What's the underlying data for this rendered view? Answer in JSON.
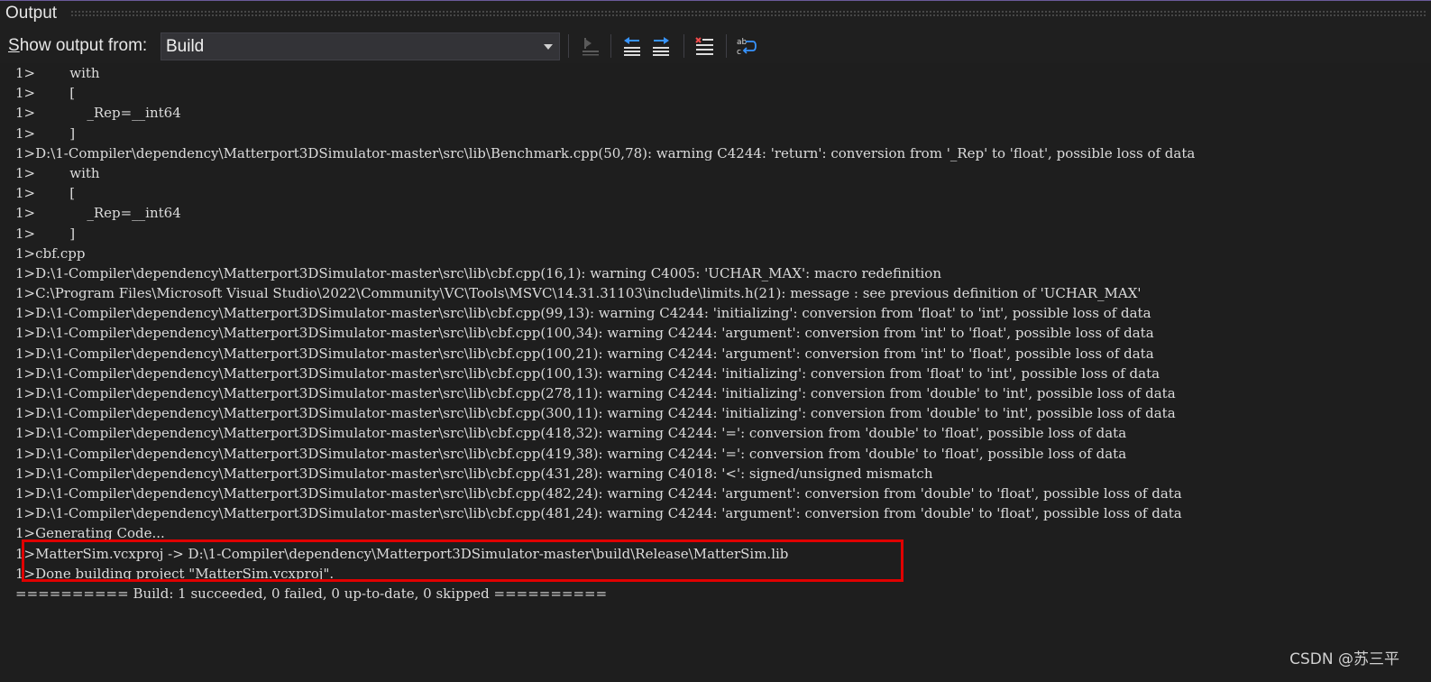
{
  "window": {
    "title": "Output"
  },
  "toolbar": {
    "show_output_label_underlined": "S",
    "show_output_label_rest": "how output from:",
    "source_value": "Build",
    "buttons": [
      {
        "name": "find-message-in-code-icon"
      },
      {
        "name": "go-to-previous-message-icon"
      },
      {
        "name": "go-to-next-message-icon"
      },
      {
        "name": "clear-all-icon"
      },
      {
        "name": "toggle-word-wrap-icon"
      }
    ]
  },
  "output": {
    "lines": [
      "1>        with",
      "1>        [",
      "1>            _Rep=__int64",
      "1>        ]",
      "1>D:\\1-Compiler\\dependency\\Matterport3DSimulator-master\\src\\lib\\Benchmark.cpp(50,78): warning C4244: 'return': conversion from '_Rep' to 'float', possible loss of data",
      "1>        with",
      "1>        [",
      "1>            _Rep=__int64",
      "1>        ]",
      "1>cbf.cpp",
      "1>D:\\1-Compiler\\dependency\\Matterport3DSimulator-master\\src\\lib\\cbf.cpp(16,1): warning C4005: 'UCHAR_MAX': macro redefinition",
      "1>C:\\Program Files\\Microsoft Visual Studio\\2022\\Community\\VC\\Tools\\MSVC\\14.31.31103\\include\\limits.h(21): message : see previous definition of 'UCHAR_MAX'",
      "1>D:\\1-Compiler\\dependency\\Matterport3DSimulator-master\\src\\lib\\cbf.cpp(99,13): warning C4244: 'initializing': conversion from 'float' to 'int', possible loss of data",
      "1>D:\\1-Compiler\\dependency\\Matterport3DSimulator-master\\src\\lib\\cbf.cpp(100,34): warning C4244: 'argument': conversion from 'int' to 'float', possible loss of data",
      "1>D:\\1-Compiler\\dependency\\Matterport3DSimulator-master\\src\\lib\\cbf.cpp(100,21): warning C4244: 'argument': conversion from 'int' to 'float', possible loss of data",
      "1>D:\\1-Compiler\\dependency\\Matterport3DSimulator-master\\src\\lib\\cbf.cpp(100,13): warning C4244: 'initializing': conversion from 'float' to 'int', possible loss of data",
      "1>D:\\1-Compiler\\dependency\\Matterport3DSimulator-master\\src\\lib\\cbf.cpp(278,11): warning C4244: 'initializing': conversion from 'double' to 'int', possible loss of data",
      "1>D:\\1-Compiler\\dependency\\Matterport3DSimulator-master\\src\\lib\\cbf.cpp(300,11): warning C4244: 'initializing': conversion from 'double' to 'int', possible loss of data",
      "1>D:\\1-Compiler\\dependency\\Matterport3DSimulator-master\\src\\lib\\cbf.cpp(418,32): warning C4244: '=': conversion from 'double' to 'float', possible loss of data",
      "1>D:\\1-Compiler\\dependency\\Matterport3DSimulator-master\\src\\lib\\cbf.cpp(419,38): warning C4244: '=': conversion from 'double' to 'float', possible loss of data",
      "1>D:\\1-Compiler\\dependency\\Matterport3DSimulator-master\\src\\lib\\cbf.cpp(431,28): warning C4018: '<': signed/unsigned mismatch",
      "1>D:\\1-Compiler\\dependency\\Matterport3DSimulator-master\\src\\lib\\cbf.cpp(482,24): warning C4244: 'argument': conversion from 'double' to 'float', possible loss of data",
      "1>D:\\1-Compiler\\dependency\\Matterport3DSimulator-master\\src\\lib\\cbf.cpp(481,24): warning C4244: 'argument': conversion from 'double' to 'float', possible loss of data",
      "1>Generating Code...",
      "1>MatterSim.vcxproj -> D:\\1-Compiler\\dependency\\Matterport3DSimulator-master\\build\\Release\\MatterSim.lib",
      "1>Done building project \"MatterSim.vcxproj\".",
      "========== Build: 1 succeeded, 0 failed, 0 up-to-date, 0 skipped =========="
    ]
  },
  "watermark": {
    "text": "CSDN @苏三平"
  },
  "colors": {
    "background": "#1e1e1e",
    "text": "#dcdcdc",
    "highlight_border": "#e00000",
    "title_accent": "#6a5a9a"
  }
}
